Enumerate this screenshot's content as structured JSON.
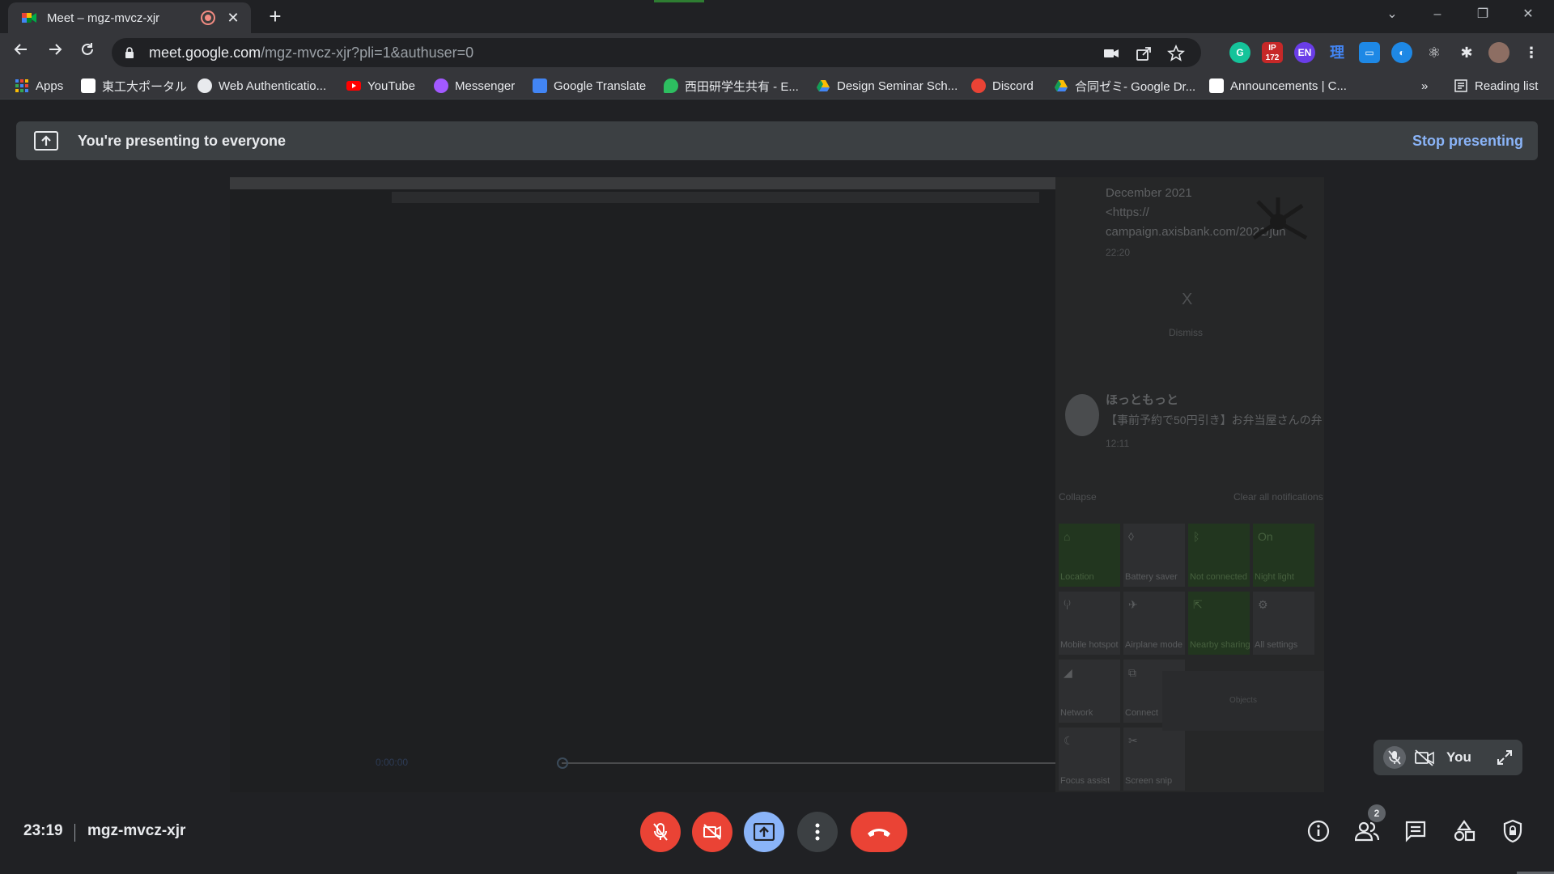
{
  "browser": {
    "tab": {
      "title": "Meet – mgz-mvcz-xjr",
      "close_glyph": "✕"
    },
    "new_tab_glyph": "+",
    "window_controls": {
      "minimize": "–",
      "restore": "❐",
      "close": "✕",
      "tab_search": "⌄"
    },
    "address": {
      "host": "meet.google.com",
      "path": "/mgz-mvcz-xjr?pli=1&authuser=0"
    },
    "extensions": {
      "badge_count": "172",
      "en_label": "EN",
      "kanji_label": "理"
    },
    "bookmarks": [
      {
        "label": "Apps",
        "icon": "apps-grid-icon",
        "color": "#4285f4"
      },
      {
        "label": "東工大ポータル",
        "icon": "titech-icon",
        "color": "#ffffff"
      },
      {
        "label": "Web Authenticatio...",
        "icon": "globe-icon",
        "color": "#e8eaed"
      },
      {
        "label": "YouTube",
        "icon": "youtube-icon",
        "color": "#ff0000"
      },
      {
        "label": "Messenger",
        "icon": "messenger-icon",
        "color": "#a259ff"
      },
      {
        "label": "Google Translate",
        "icon": "translate-icon",
        "color": "#4285f4"
      },
      {
        "label": "西田研学生共有 - E...",
        "icon": "evernote-icon",
        "color": "#2dbe60"
      },
      {
        "label": "Design Seminar Sch...",
        "icon": "drive-icon",
        "color": "#fbbc04"
      },
      {
        "label": "Discord",
        "icon": "discord-icon",
        "color": "#ea4335"
      },
      {
        "label": "合同ゼミ- Google Dr...",
        "icon": "drive-icon",
        "color": "#fbbc04"
      },
      {
        "label": "Announcements | C...",
        "icon": "canvas-icon",
        "color": "#ffffff"
      }
    ],
    "bookmarks_more": "»",
    "reading_list": "Reading list"
  },
  "meet": {
    "banner": {
      "text": "You're presenting to everyone",
      "stop": "Stop presenting"
    },
    "shared_screen": {
      "notification_text": [
        "December 2021",
        "<https://",
        "campaign.axisbank.com/2021/jun",
        "22:20"
      ],
      "dismiss_x": "X",
      "dismiss": "Dismiss",
      "second_sender": "ほっともっと",
      "second_message": "【事前予約で50円引き】お弁当屋さんの弁",
      "second_time": "12:11",
      "collapse": "Collapse",
      "clear_all": "Clear all notifications",
      "tiles": [
        "Location",
        "Battery saver",
        "Not connected",
        "Night light",
        "Mobile hotspot",
        "Airplane mode",
        "Nearby sharing",
        "All settings",
        "Network",
        "Connect",
        "Focus assist",
        "Screen snip"
      ],
      "snip_label": "Objects"
    },
    "self_view_name": "You",
    "meeting_time": "23:19",
    "meeting_code": "mgz-mvcz-xjr",
    "participants_count": "2",
    "colors": {
      "red": "#ea4335",
      "blue": "#8ab4f8",
      "dark": "#202124"
    }
  }
}
